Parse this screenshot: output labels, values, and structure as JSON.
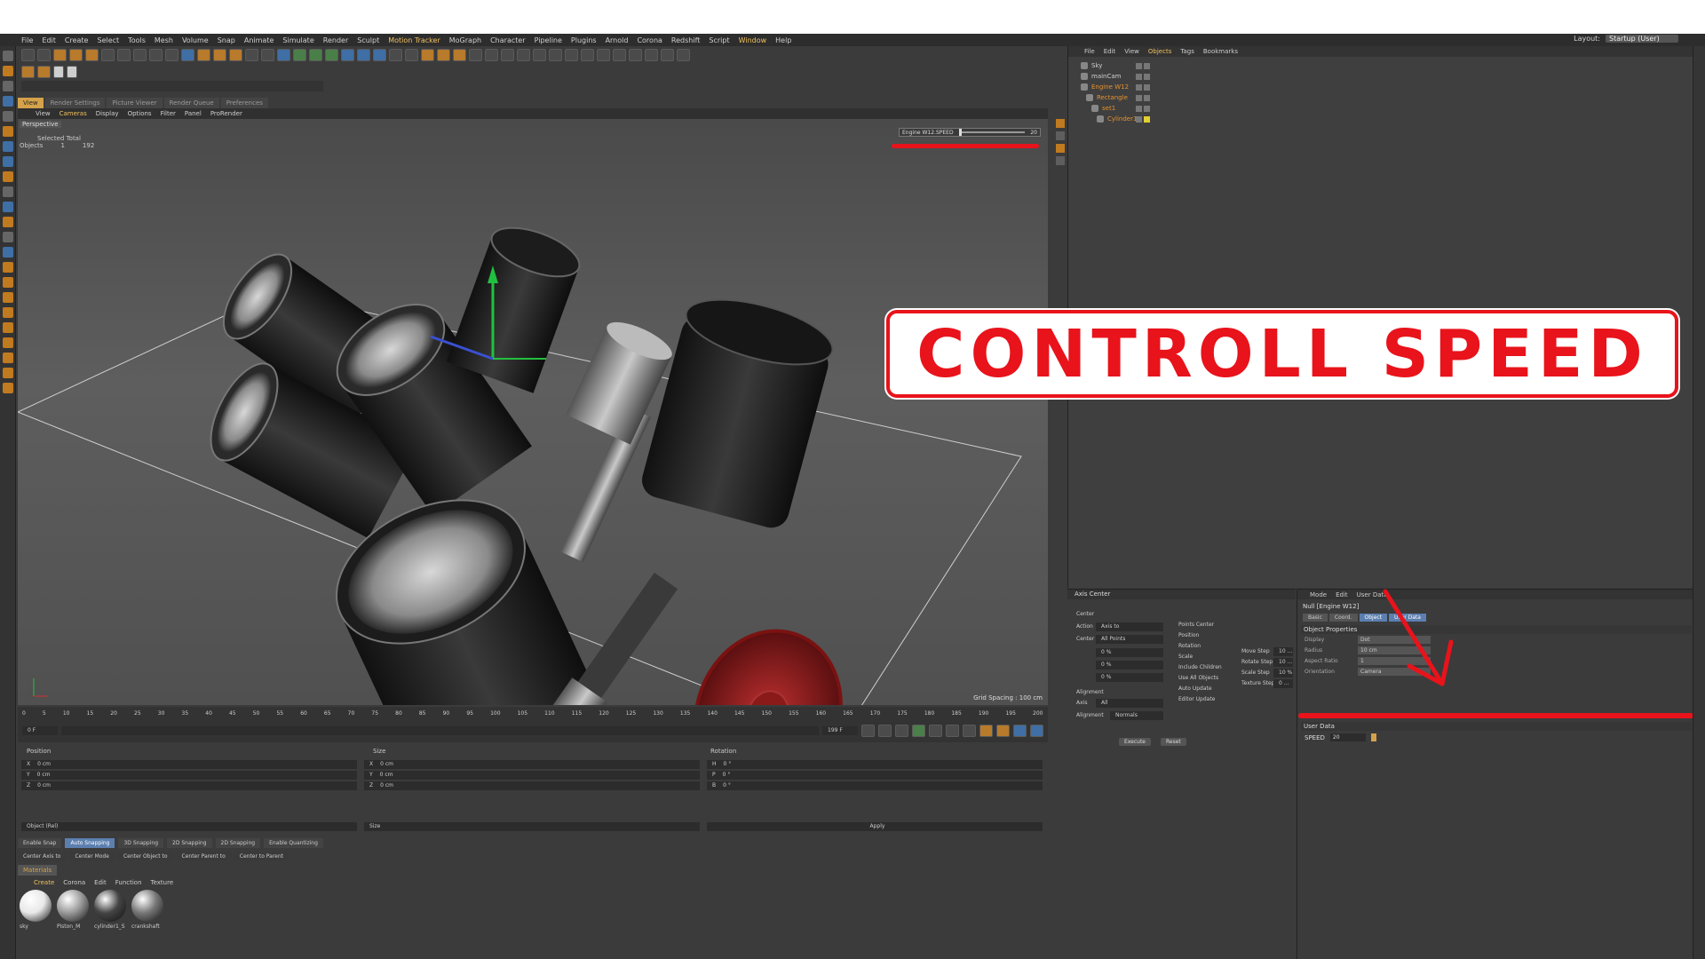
{
  "menubar": [
    "File",
    "Edit",
    "Create",
    "Select",
    "Tools",
    "Mesh",
    "Volume",
    "Snap",
    "Animate",
    "Simulate",
    "Render",
    "Sculpt",
    "Motion Tracker",
    "MoGraph",
    "Character",
    "Pipeline",
    "Plugins",
    "Arnold",
    "Corona",
    "Redshift",
    "Script",
    "Window",
    "Help"
  ],
  "layout": {
    "label": "Layout:",
    "value": "Startup (User)"
  },
  "viewport_tabs": [
    "View",
    "Render Settings",
    "Picture Viewer",
    "Render Queue",
    "Preferences"
  ],
  "viewport_menu": [
    "View",
    "Cameras",
    "Display",
    "Options",
    "Filter",
    "Panel",
    "ProRender"
  ],
  "viewport": {
    "label": "Perspective",
    "stats_header": "Selected Total",
    "stats_label": "Objects",
    "stats_selected": "1",
    "stats_total": "192",
    "hud_label": "Engine W12.SPEED",
    "hud_value": "20",
    "grid_spacing": "Grid Spacing : 100 cm"
  },
  "timeline": {
    "ticks": [
      "0",
      "5",
      "10",
      "15",
      "20",
      "25",
      "30",
      "35",
      "40",
      "45",
      "50",
      "55",
      "60",
      "65",
      "70",
      "75",
      "80",
      "85",
      "90",
      "95",
      "100",
      "105",
      "110",
      "115",
      "120",
      "125",
      "130",
      "135",
      "140",
      "145",
      "150",
      "155",
      "160",
      "165",
      "170",
      "175",
      "180",
      "185",
      "190",
      "195",
      "200"
    ],
    "current": "0 F",
    "end_frame": "0 F",
    "start": "0 F",
    "max": "199 F"
  },
  "coords": {
    "headers": [
      "Position",
      "Size",
      "Rotation"
    ],
    "rows": [
      {
        "p_axis": "X",
        "p_val": "0 cm",
        "s_axis": "X",
        "s_val": "0 cm",
        "r_axis": "H",
        "r_val": "0 °"
      },
      {
        "p_axis": "Y",
        "p_val": "0 cm",
        "s_axis": "Y",
        "s_val": "0 cm",
        "r_axis": "P",
        "r_val": "0 °"
      },
      {
        "p_axis": "Z",
        "p_val": "0 cm",
        "s_axis": "Z",
        "s_val": "0 cm",
        "r_axis": "B",
        "r_val": "0 °"
      }
    ],
    "mode": "Object (Rel)",
    "size_mode": "Size",
    "apply": "Apply"
  },
  "snap": {
    "row1": [
      "Enable Snap",
      "Auto Snapping",
      "3D Snapping",
      "2D Snapping",
      "2D Snapping",
      "Enable Quantizing"
    ],
    "row2": [
      "Center Axis to",
      "Center Mode",
      "Center Object to",
      "Center Parent to",
      "Center to Parent"
    ]
  },
  "materials": {
    "tab": "Materials",
    "menu": [
      "Create",
      "Corona",
      "Edit",
      "Function",
      "Texture"
    ],
    "items": [
      {
        "name": "sky",
        "color": "#e8e8e8"
      },
      {
        "name": "Piston_M",
        "color": "#9a9a9a"
      },
      {
        "name": "cylinder1_S",
        "color": "#444444"
      },
      {
        "name": "crankshaft",
        "color": "#777777"
      }
    ]
  },
  "object_manager": {
    "menu": [
      "File",
      "Edit",
      "View",
      "Objects",
      "Tags",
      "Bookmarks"
    ],
    "objects": [
      {
        "name": "Sky",
        "orange": false
      },
      {
        "name": "mainCam",
        "orange": false
      },
      {
        "name": "Engine W12",
        "orange": true
      },
      {
        "name": "Rectangle",
        "orange": true
      },
      {
        "name": "set1",
        "orange": true
      },
      {
        "name": "Cylinder1",
        "orange": true
      }
    ]
  },
  "axis_center": {
    "title": "Axis Center",
    "center_label": "Center",
    "action_label": "Action",
    "action_value": "Axis to",
    "center_field_label": "Center",
    "center_field_value": "All Points",
    "xyz_values": [
      "0 %",
      "0 %",
      "0 %"
    ],
    "alignment_label": "Alignment",
    "axis_label": "Axis",
    "axis_value": "All",
    "alignment_field_label": "Alignment",
    "alignment_value": "Normals",
    "options": [
      "Points Center",
      "Position",
      "Rotation",
      "Scale",
      "Include Children",
      "Use All Objects",
      "Auto Update",
      "Editor Update"
    ],
    "steps": [
      {
        "label": "Move Step",
        "val": "10 ..."
      },
      {
        "label": "Rotate Step",
        "val": "10 ..."
      },
      {
        "label": "Scale Step",
        "val": "10 %"
      },
      {
        "label": "Texture Step",
        "val": "0 ..."
      }
    ],
    "execute": "Execute",
    "reset": "Reset"
  },
  "attributes": {
    "menu": [
      "Mode",
      "Edit",
      "User Data"
    ],
    "title": "Null [Engine W12]",
    "tabs": [
      "Basic",
      "Coord.",
      "Object",
      "User Data"
    ],
    "active_tab": "Object",
    "section_object": "Object Properties",
    "props": [
      {
        "label": "Display",
        "val": "Dot"
      },
      {
        "label": "Radius",
        "val": "10 cm"
      },
      {
        "label": "Aspect Ratio",
        "val": "1"
      },
      {
        "label": "Orientation",
        "val": "Camera"
      }
    ],
    "section_user": "User Data",
    "speed_label": "SPEED",
    "speed_value": "20"
  },
  "callout": {
    "text": "CONTROLL SPEED"
  },
  "colors": {
    "accent_red": "#e8131b",
    "accent_orange": "#d4a24a",
    "bg": "#3b3b3b"
  }
}
